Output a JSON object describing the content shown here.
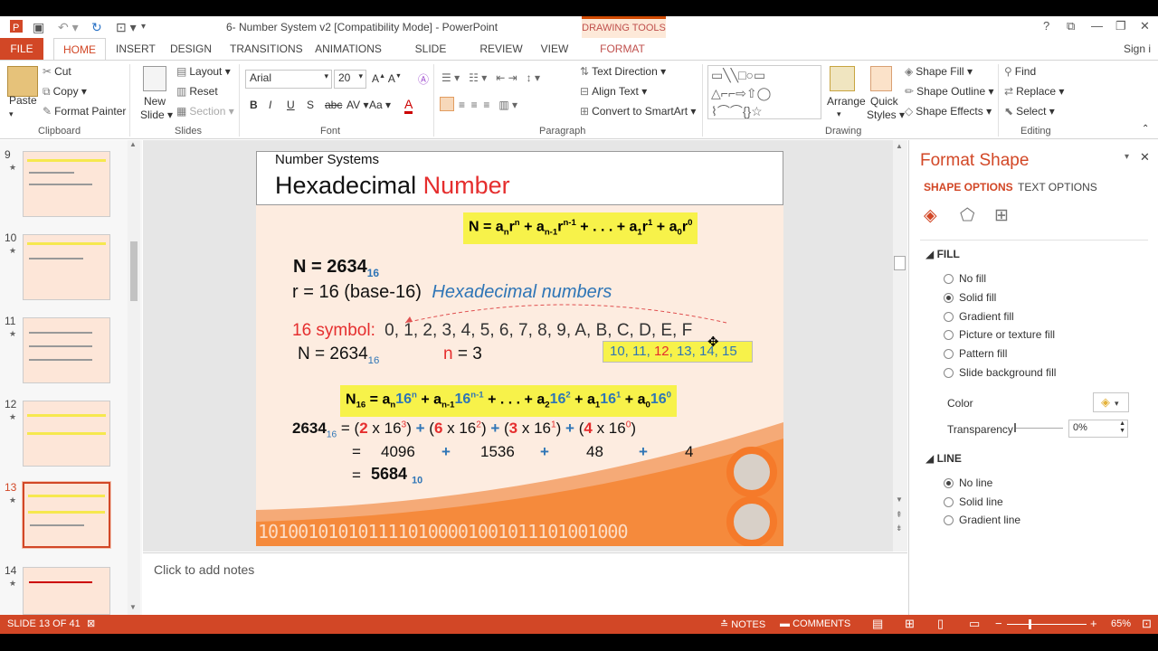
{
  "window": {
    "title": "6- Number System v2 [Compatibility Mode] - PowerPoint",
    "context_tab_group": "DRAWING TOOLS",
    "signin": "Sign i"
  },
  "tabs": [
    "FILE",
    "HOME",
    "INSERT",
    "DESIGN",
    "TRANSITIONS",
    "ANIMATIONS",
    "SLIDE SHOW",
    "REVIEW",
    "VIEW",
    "FORMAT"
  ],
  "ribbon": {
    "clipboard": {
      "paste": "Paste",
      "cut": "Cut",
      "copy": "Copy",
      "format_painter": "Format Painter",
      "label": "Clipboard"
    },
    "slides": {
      "new_slide_1": "New",
      "new_slide_2": "Slide",
      "layout": "Layout",
      "reset": "Reset",
      "section": "Section",
      "label": "Slides"
    },
    "font": {
      "family": "Arial",
      "size": "20",
      "label": "Font"
    },
    "paragraph": {
      "text_direction": "Text Direction",
      "align_text": "Align Text",
      "smartart": "Convert to SmartArt",
      "label": "Paragraph"
    },
    "drawing": {
      "arrange_1": "Arrange",
      "quick_1": "Quick",
      "quick_2": "Styles",
      "shape_fill": "Shape Fill",
      "shape_outline": "Shape Outline",
      "shape_effects": "Shape Effects",
      "label": "Drawing"
    },
    "editing": {
      "find": "Find",
      "replace": "Replace",
      "select": "Select",
      "label": "Editing"
    }
  },
  "thumbnails": [
    {
      "num": "9",
      "star": "★"
    },
    {
      "num": "10",
      "star": "★"
    },
    {
      "num": "11",
      "star": "★"
    },
    {
      "num": "12",
      "star": "★"
    },
    {
      "num": "13",
      "star": "★"
    },
    {
      "num": "14",
      "star": "★"
    }
  ],
  "slide": {
    "small_title": "Number Systems",
    "title_a": "Hexadecimal ",
    "title_b": "Number",
    "r_line_a": "r = 16 (base-16)",
    "r_line_b": "Hexadecimal numbers",
    "symbol_label": "16 symbol:",
    "symbols": "0, 1, 2, 3, 4, 5, 6, 7, 8, 9, A, B, C, D, E, F",
    "tooltip_a": "10, 11, ",
    "tooltip_b": "12",
    "tooltip_c": ", 13, 14, 15",
    "n_eq": "N = 2634",
    "n_sub": "16",
    "n_label": "n",
    "n_val": " = 3",
    "eq_sign1": "=",
    "row2_a": "4096",
    "row2_b": "1536",
    "row2_c": "48",
    "row2_d": "4",
    "plus": "+",
    "eq_sign2": "=",
    "result": "5684",
    "result_sub": "10",
    "binary_text": "1010010101011110100001001011101001000"
  },
  "notes_placeholder": "Click to add notes",
  "format_pane": {
    "title": "Format Shape",
    "tab_shape": "SHAPE OPTIONS",
    "tab_text": "TEXT OPTIONS",
    "fill_header": "FILL",
    "fill_options": [
      "No fill",
      "Solid fill",
      "Gradient fill",
      "Picture or texture fill",
      "Pattern fill",
      "Slide background fill"
    ],
    "color_label": "Color",
    "transparency_label": "Transparency",
    "transparency_value": "0%",
    "line_header": "LINE",
    "line_options": [
      "No line",
      "Solid line",
      "Gradient line"
    ]
  },
  "status": {
    "slide": "SLIDE 13 OF 41",
    "notes": "NOTES",
    "comments": "COMMENTS",
    "zoom": "65%"
  }
}
